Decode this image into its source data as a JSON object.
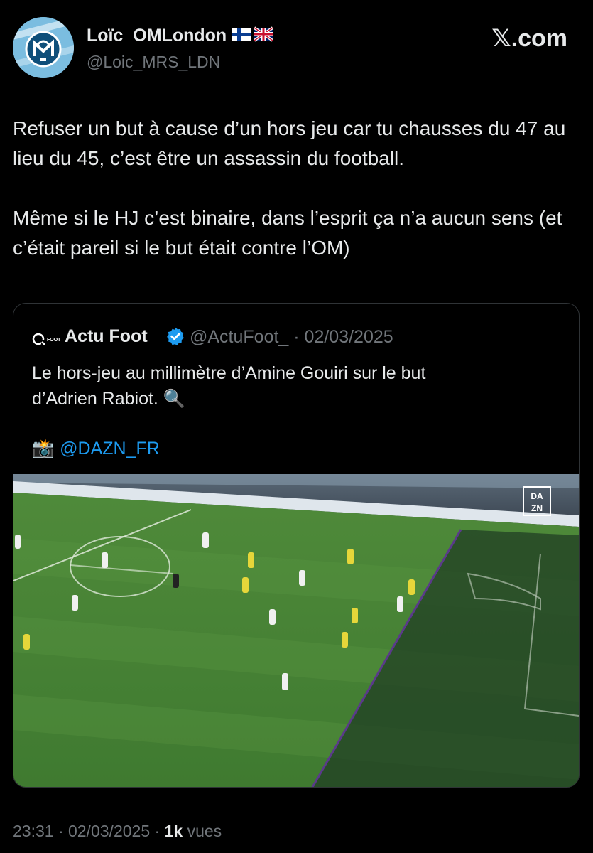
{
  "author": {
    "name": "Loïc_OMLondon",
    "handle": "@Loic_MRS_LDN",
    "avatar_icon": "olympique-marseille-crest"
  },
  "brand": "𝕏.com",
  "tweet": {
    "paragraphs": [
      "Refuser un but à cause d’un hors jeu car tu chausses du 47 au lieu du 45, c’est être un assassin du football.",
      "Même si le HJ c’est binaire, dans l’esprit ça n’a aucun sens (et c’était pareil si le but était contre l’OM)"
    ]
  },
  "quote": {
    "avatar_icon": "actu-foot-logo",
    "name": "Actu Foot",
    "verified_icon": "verified-badge-icon",
    "meta": "@ActuFoot_ · 02/03/2025",
    "text_line1": "Le hors-jeu au millimètre d’Amine Gouiri sur le but",
    "text_line2": "d’Adrien Rabiot. 🔍",
    "credit_icon": "camera-flash-emoji",
    "credit": "@DAZN_FR",
    "media_icon": "football-offside-image",
    "broadcaster_logo": [
      "DA",
      "ZN"
    ]
  },
  "footer": {
    "time": "23:31",
    "date": "02/03/2025",
    "views": "1k",
    "views_label": "vues"
  },
  "colors": {
    "background": "#000000",
    "text": "#e7e9ea",
    "secondary": "#71767b",
    "link": "#1d9bf0",
    "border": "#2f3336"
  }
}
